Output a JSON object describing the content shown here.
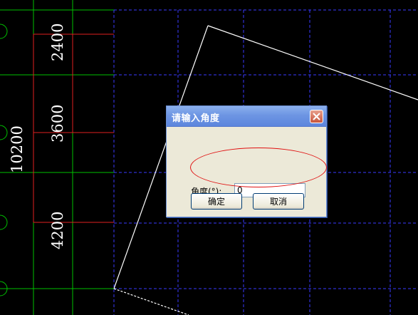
{
  "dimensions": {
    "total": "10200",
    "segments": [
      "2400",
      "3600",
      "4200"
    ]
  },
  "dialog": {
    "title": "请输入角度",
    "angle_label": "角度(°):",
    "angle_value": "0",
    "ok_label": "确定",
    "cancel_label": "取消"
  },
  "colors": {
    "axis_line": "#00c000",
    "dim_line": "#e02020",
    "grid": "#3a3aff",
    "outline": "#ffffff",
    "highlight": "#e01010"
  },
  "icons": {
    "close": "close-icon"
  }
}
